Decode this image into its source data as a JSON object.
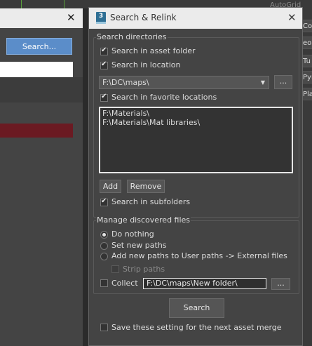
{
  "background": {
    "viewport_label": "AutoGrid",
    "back_dialog": {
      "close_glyph": "✕",
      "search_label": "Search..."
    },
    "side_buttons": [
      "Co",
      "eoS",
      "Tu",
      "Pyr",
      "Pla"
    ]
  },
  "dialog": {
    "title": "Search & Relink",
    "app_icon_text": "3",
    "close_glyph": "✕"
  },
  "search_dirs": {
    "group_label": "Search directories",
    "asset_folder": {
      "label": "Search in asset folder",
      "checked": true
    },
    "location": {
      "label": "Search in location",
      "checked": true
    },
    "location_path": "F:\\DC\\maps\\",
    "browse_label": "...",
    "favorite": {
      "label": "Search in favorite locations",
      "checked": true
    },
    "favorites": [
      "F:\\Materials\\",
      "F:\\Materials\\Mat libraries\\"
    ],
    "add_label": "Add",
    "remove_label": "Remove",
    "subfolders": {
      "label": "Search in subfolders",
      "checked": true
    }
  },
  "manage": {
    "group_label": "Manage discovered files",
    "options": [
      {
        "label": "Do nothing",
        "selected": true
      },
      {
        "label": "Set new paths",
        "selected": false
      },
      {
        "label": "Add new paths to User paths -> External files",
        "selected": false
      }
    ],
    "strip_paths": {
      "label": "Strip paths",
      "checked": false,
      "enabled": false
    },
    "collect": {
      "label": "Collect",
      "checked": false
    },
    "collect_path": "F:\\DC\\maps\\New folder\\",
    "collect_browse_label": "..."
  },
  "footer": {
    "search_label": "Search",
    "save_setting": {
      "label": "Save these setting for the next asset merge",
      "checked": false
    }
  }
}
